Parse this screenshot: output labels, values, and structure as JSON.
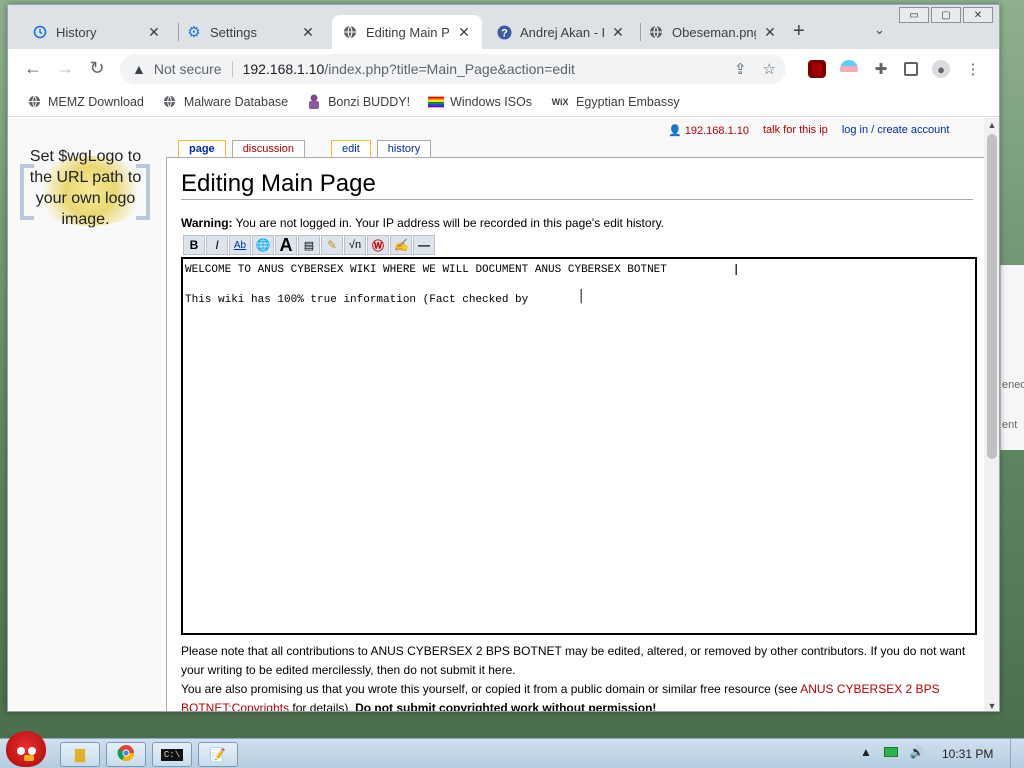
{
  "browser": {
    "tabs": [
      {
        "label": "History",
        "icon": "history-icon"
      },
      {
        "label": "Settings",
        "icon": "gear-icon"
      },
      {
        "label": "Editing Main Page",
        "icon": "globe-icon"
      },
      {
        "label": "Andrej Akan - H",
        "icon": "help-icon"
      },
      {
        "label": "Obeseman.png",
        "icon": "globe-icon"
      }
    ],
    "window_controls": [
      "▭",
      "▢",
      "✕"
    ],
    "omnibox": {
      "security_label": "Not secure",
      "url_host": "192.168.1.10",
      "url_path": "/index.php?title=Main_Page&action=edit"
    },
    "bookmarks": [
      {
        "label": "MEMZ Download",
        "icon": "globe-icon"
      },
      {
        "label": "Malware Database",
        "icon": "globe-icon"
      },
      {
        "label": "Bonzi BUDDY!",
        "icon": "bonzi-icon"
      },
      {
        "label": "Windows ISOs",
        "icon": "rainbow-flag-icon"
      },
      {
        "label": "Egyptian Embassy",
        "icon": "wix-icon"
      }
    ],
    "bookmark_wix_text": "WiX"
  },
  "wiki": {
    "logo_text": "Set $wgLogo to the URL path to your own logo image.",
    "personal": {
      "ip": "192.168.1.10",
      "talk": "talk for this ip",
      "login": "log in / create account"
    },
    "actions": {
      "page": "page",
      "discussion": "discussion",
      "edit": "edit",
      "history": "history"
    },
    "heading": "Editing Main Page",
    "warning_bold": "Warning:",
    "warning_text": " You are not logged in. Your IP address will be recorded in this page's edit history.",
    "edit_text": "WELCOME TO ANUS CYBERSEX WIKI WHERE WE WILL DOCUMENT ANUS CYBERSEX BOTNET\n\nThis wiki has 100% true information (Fact checked by ",
    "notice": {
      "line1": "Please note that all contributions to ANUS CYBERSEX 2 BPS BOTNET may be edited, altered, or removed by other contributors. If you do not want your writing to be edited mercilessly, then do not submit it here.",
      "line2_pre": "You are also promising us that you wrote this yourself, or copied it from a public domain or similar free resource (see ",
      "line2_link": "ANUS CYBERSEX 2 BPS BOTNET:Copyrights",
      "line2_post": " for details). ",
      "line2_bold": "Do not submit copyrighted work without permission!"
    }
  },
  "peek": {
    "text1": "ened",
    "text2": "ent"
  },
  "taskbar": {
    "clock": "10:31 PM"
  },
  "colors": {
    "link_red": "#ba0000",
    "link_blue": "#002bb8",
    "tab_highlight": "#fabd23"
  }
}
